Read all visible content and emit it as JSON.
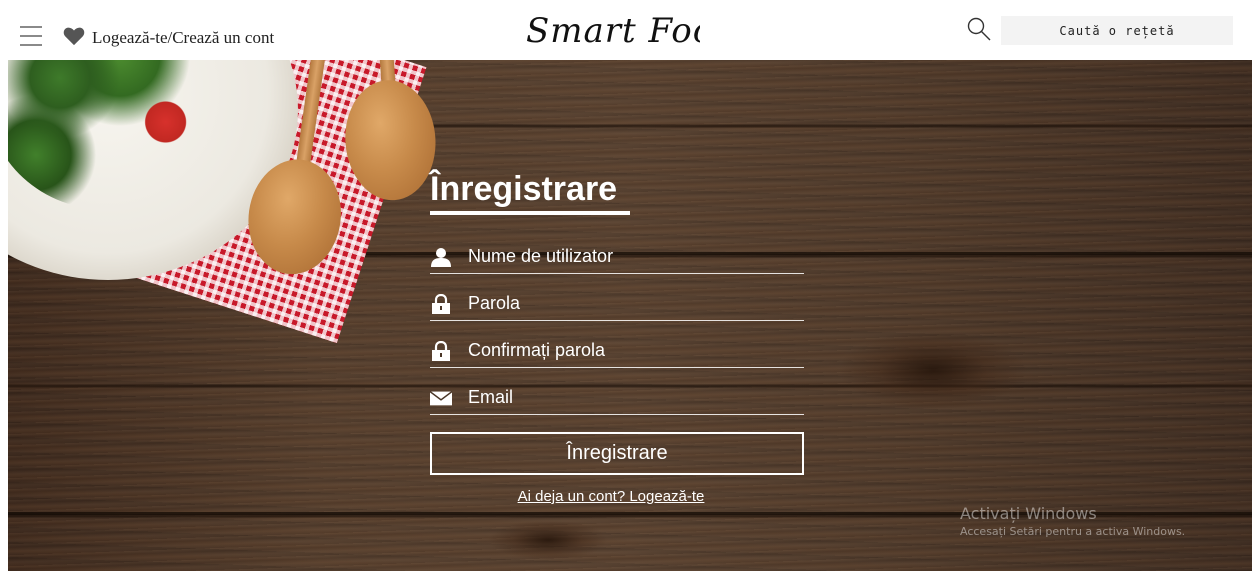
{
  "header": {
    "login_label": "Logează-te/Crează un cont",
    "logo_text": "Smart Food",
    "search_placeholder": "Caută o rețetă"
  },
  "form": {
    "title": "Înregistrare",
    "fields": [
      {
        "icon": "user-icon",
        "placeholder": "Nume de utilizator"
      },
      {
        "icon": "lock-icon",
        "placeholder": "Parola"
      },
      {
        "icon": "lock-icon",
        "placeholder": "Confirmați parola"
      },
      {
        "icon": "envelope-icon",
        "placeholder": "Email"
      }
    ],
    "submit_label": "Înregistrare",
    "login_prompt": "Ai deja un cont? Logează-te"
  },
  "watermark": {
    "line1": "Activați Windows",
    "line2": "Accesați Setări pentru a activa Windows."
  },
  "colors": {
    "text_on_wood": "#ffffff",
    "search_bg": "#f3f3f3",
    "napkin_red": "#c8192a"
  }
}
